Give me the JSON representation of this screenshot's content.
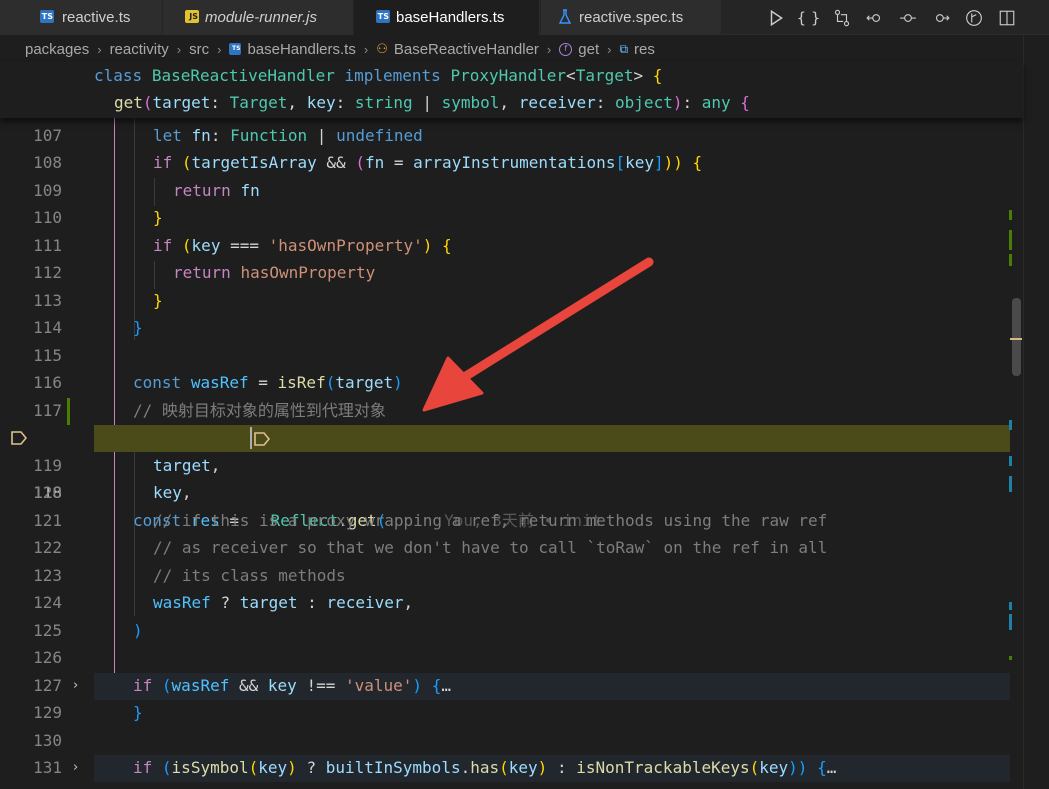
{
  "tabs": [
    {
      "label": "reactive.ts",
      "icon": "TS",
      "kind": "ts"
    },
    {
      "label": "module-runner.js",
      "icon": "JS",
      "kind": "js"
    },
    {
      "label": "baseHandlers.ts",
      "icon": "TS",
      "kind": "ts"
    },
    {
      "label": "reactive.spec.ts",
      "icon": "flask-icon",
      "kind": "test"
    }
  ],
  "toolbar": {
    "braces_label": "{ }"
  },
  "breadcrumb": {
    "items": [
      "packages",
      "reactivity",
      "src",
      "baseHandlers.ts",
      "BaseReactiveHandler",
      "get",
      "res"
    ]
  },
  "sticky": {
    "class_kw": "class",
    "class_name": "BaseReactiveHandler",
    "implements_kw": "implements",
    "iface": "ProxyHandler",
    "lt": "<",
    "iface_arg": "Target",
    "gt": ">",
    "open": "{",
    "method": "get",
    "p_open": "(",
    "p1": "target",
    "colon1": ":",
    "t1": "Target",
    "comma1": ",",
    "p2": "key",
    "colon2": ":",
    "t2a": "string",
    "pipe": "|",
    "t2b": "symbol",
    "comma2": ",",
    "p3": "receiver",
    "colon3": ":",
    "t3": "object",
    "p_close": ")",
    "colon4": ":",
    "ret": "any",
    "mopen": "{"
  },
  "lines": {
    "n107": "107",
    "n108": "108",
    "n109": "109",
    "n110": "110",
    "n111": "111",
    "n112": "112",
    "n113": "113",
    "n114": "114",
    "n115": "115",
    "n116": "116",
    "n117": "117",
    "n118": "118",
    "n119": "119",
    "n120": "120",
    "n121": "121",
    "n122": "122",
    "n123": "123",
    "n124": "124",
    "n125": "125",
    "n126": "126",
    "n127": "127",
    "n129": "129",
    "n130": "130",
    "n131": "131"
  },
  "code": {
    "l107": {
      "let": "let",
      "fn": "fn",
      "colon": ":",
      "type": "Function",
      "pipe": "|",
      "undef": "undefined"
    },
    "l108": {
      "if": "if",
      "po": "(",
      "a": "targetIsArray",
      "and": "&&",
      "po2": "(",
      "fn": "fn",
      "eq": "=",
      "arr": "arrayInstrumentations",
      "bo": "[",
      "key": "key",
      "bc": "]",
      "pc": "))",
      "brace": "{"
    },
    "l109": {
      "ret": "return",
      "fn": "fn"
    },
    "l110": {
      "close": "}"
    },
    "l111": {
      "if": "if",
      "po": "(",
      "key": "key",
      "op": "===",
      "str": "'hasOwnProperty'",
      "pc": ")",
      "brace": "{"
    },
    "l112": {
      "ret": "return",
      "fn": "hasOwnProperty"
    },
    "l113": {
      "close": "}"
    },
    "l114": {
      "close": "}"
    },
    "l116": {
      "const": "const",
      "name": "wasRef",
      "eq": "=",
      "fn": "isRef",
      "po": "(",
      "arg": "target",
      "pc": ")"
    },
    "l117": {
      "comment": "// 映射目标对象的属性到代理对象"
    },
    "l118": {
      "const": "const",
      "name": "res",
      "eq": "=",
      "obj": "Reflect",
      "dot": ".",
      "fn": "get",
      "po": "(",
      "blame": "You, 3天前 • init"
    },
    "l119": {
      "text": "target",
      "comma": ","
    },
    "l120": {
      "text": "key",
      "comma": ","
    },
    "l121": {
      "comment": "// if this is a proxy wrapping a ref, return methods using the raw ref"
    },
    "l122": {
      "comment": "// as receiver so that we don't have to call `toRaw` on the ref in all"
    },
    "l123": {
      "comment": "// its class methods"
    },
    "l124": {
      "a": "wasRef",
      "q": "?",
      "b": "target",
      "c": ":",
      "d": "receiver",
      "comma": ","
    },
    "l125": {
      "close": ")"
    },
    "l127": {
      "if": "if",
      "po": "(",
      "a": "wasRef",
      "and": "&&",
      "key": "key",
      "op": "!==",
      "str": "'value'",
      "pc": ")",
      "brace": "{",
      "ell": "…"
    },
    "l129": {
      "close": "}"
    },
    "l131": {
      "if": "if",
      "po": "(",
      "fn": "isSymbol",
      "po2": "(",
      "key": "key",
      "pc2": ")",
      "q": "?",
      "obj": "builtInSymbols",
      "dot": ".",
      "has": "has",
      "po3": "(",
      "key2": "key",
      "pc3": ")",
      "c": ":",
      "fn2": "isNonTrackableKeys",
      "po4": "(",
      "key3": "key",
      "pc4": "))",
      "brace": "{",
      "ell": "…"
    }
  },
  "colors": {
    "editor_bg": "#1e1e1e",
    "current_line_highlight": "#4b4b1a",
    "annotation_arrow": "#e8453c"
  }
}
